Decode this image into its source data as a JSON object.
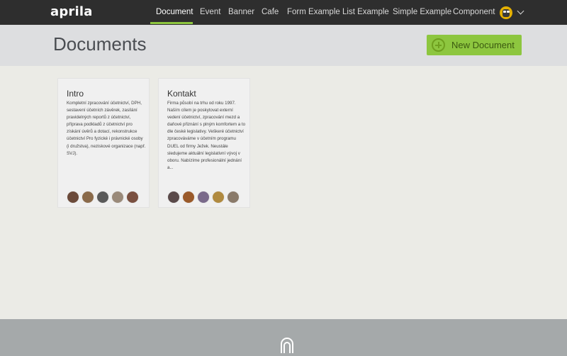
{
  "app": {
    "logo": "aprila"
  },
  "nav": {
    "items": [
      {
        "label": "Document",
        "active": true
      },
      {
        "label": "Event"
      },
      {
        "label": "Banner"
      },
      {
        "label": "Cafe"
      },
      {
        "label": "Form Example"
      },
      {
        "label": "List Example"
      },
      {
        "label": "Simple Example"
      },
      {
        "label": "Component"
      }
    ],
    "accent": "#8dc63f"
  },
  "header": {
    "title": "Documents",
    "new_button_label": "New Document",
    "new_button_icon": "plus-circle-icon"
  },
  "cards": [
    {
      "title": "Intro",
      "text": "Kompletní zpracování účetnictví, DPH, sestavení účetních závěrek, zasílání pravidelných reportů z účetnictví, příprava podkladů z účetnictví pro získání úvěrů a dotací, rekonstrukce účetnictví Pro fyzické i právnické osoby (i družstva), neziskové organizace (např. SVJ).",
      "avatar_colors": [
        "#6b4a3a",
        "#8a6a4a",
        "#5a5a5a",
        "#9a8a7a",
        "#7a5040"
      ]
    },
    {
      "title": "Kontakt",
      "text": "Firma působí na trhu od roku 1997. Naším cílem je poskytovat externí vedení účetnictví, zpracování mezd a daňové přiznání s plným komfortem a to dle české legislativy. Veškeré účetnictví zpracováváme v účetním programu DUEL od firmy Ježek. Neustále sledujeme aktuální legislativní vývoj v oboru. Nabízíme profesionální jednání a...",
      "avatar_colors": [
        "#5a4a4a",
        "#9a5a2a",
        "#7a6a8a",
        "#b08a40",
        "#8a7a6a"
      ]
    }
  ]
}
